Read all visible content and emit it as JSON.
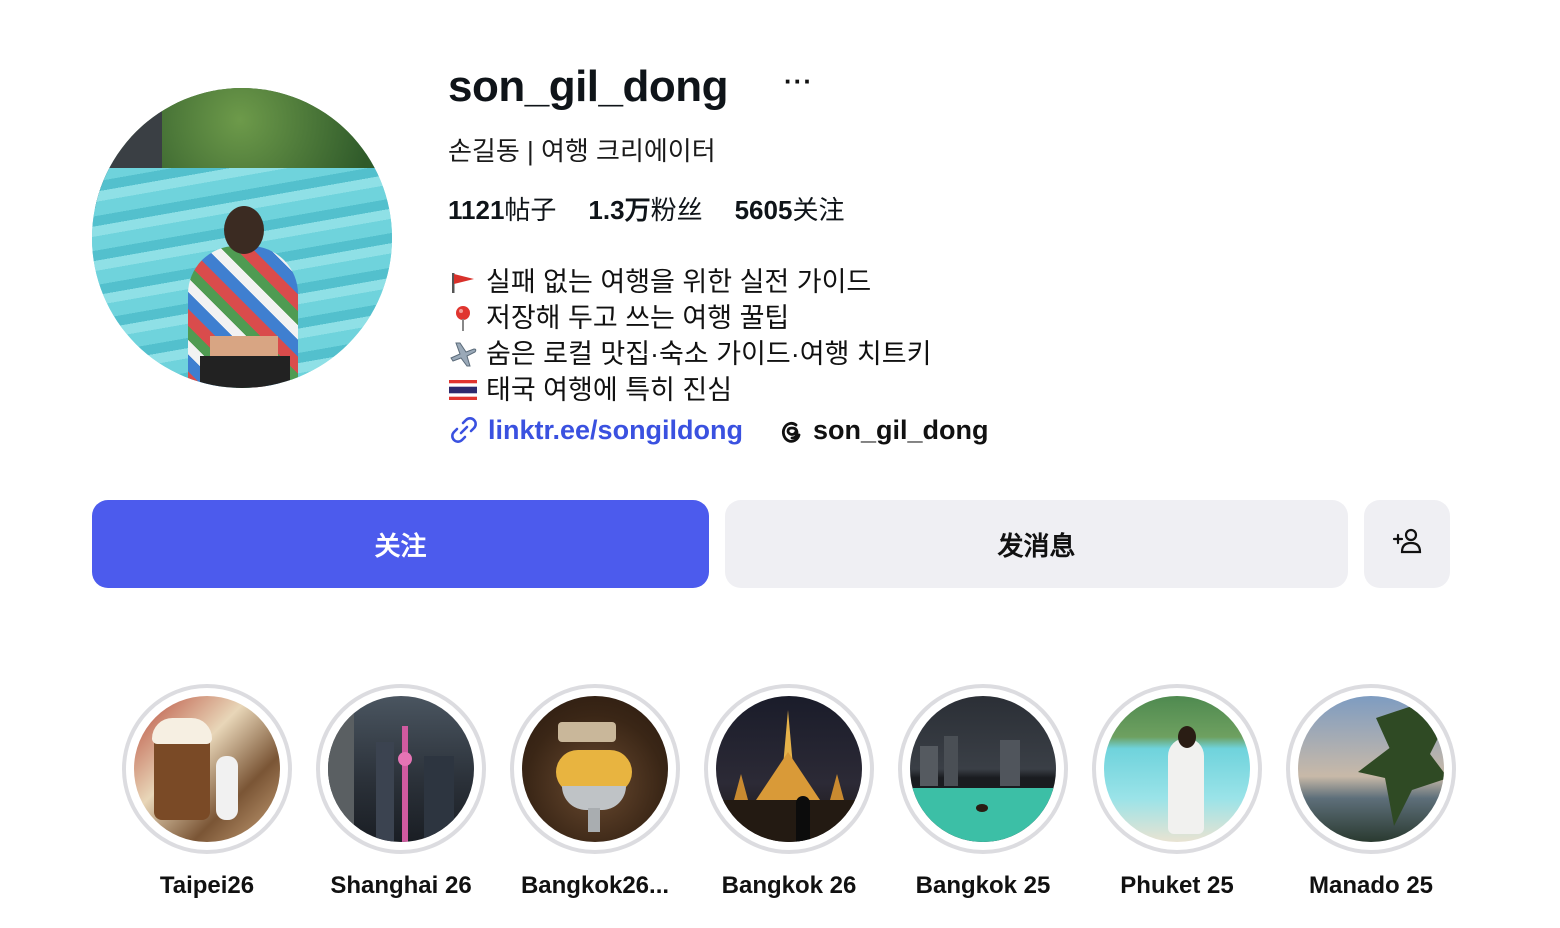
{
  "profile": {
    "username": "son_gil_dong",
    "more": "···",
    "full_name": "손길동 | 여행 크리에이터",
    "stats": [
      {
        "num": "1121",
        "label": "帖子"
      },
      {
        "num": "1.3万",
        "label": "粉丝"
      },
      {
        "num": "5605",
        "label": "关注"
      }
    ],
    "bio": [
      {
        "emoji": "red-flag-icon",
        "text": "실패 없는 여행을 위한 실전 가이드"
      },
      {
        "emoji": "pushpin-icon",
        "text": "저장해 두고 쓰는 여행 꿀팁"
      },
      {
        "emoji": "airplane-icon",
        "text": "숨은 로컬 맛집·숙소 가이드·여행 치트키"
      },
      {
        "emoji": "thailand-flag-icon",
        "text": "태국 여행에 특히 진심"
      }
    ],
    "link": {
      "icon": "link-icon",
      "text": "linktr.ee/songildong"
    },
    "threads": {
      "icon": "threads-icon",
      "text": "son_gil_dong"
    }
  },
  "actions": {
    "follow": "关注",
    "message": "发消息",
    "add_user_icon": "add-person-icon"
  },
  "highlights": [
    {
      "label": "Taipei26"
    },
    {
      "label": "Shanghai 26"
    },
    {
      "label": "Bangkok26..."
    },
    {
      "label": "Bangkok 26"
    },
    {
      "label": "Bangkok 25"
    },
    {
      "label": "Phuket 25"
    },
    {
      "label": "Manado 25"
    }
  ],
  "colors": {
    "accent": "#4c5bed",
    "link": "#3a51e0",
    "button_secondary": "#efeff3"
  }
}
